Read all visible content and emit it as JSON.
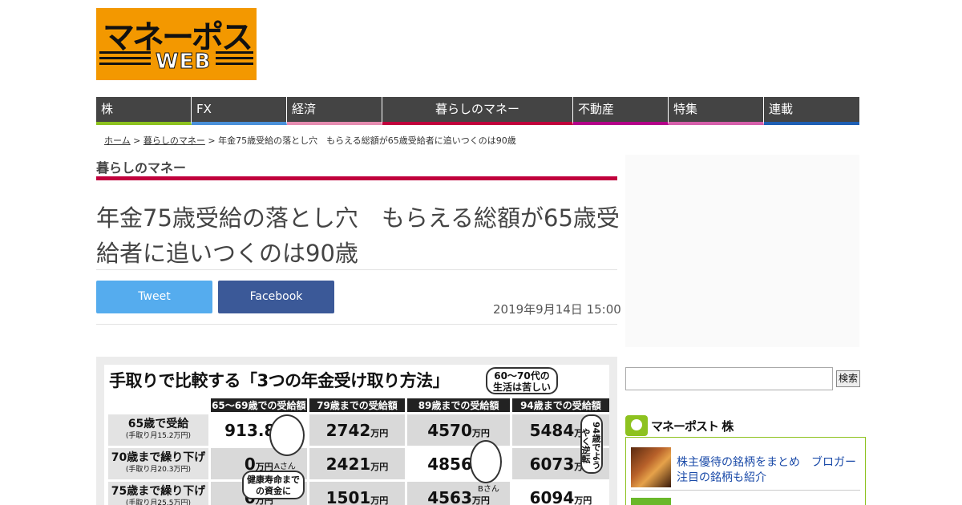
{
  "logo": {
    "main": "マネーポスト",
    "sub": "WEB"
  },
  "nav": [
    {
      "label": "株",
      "color": "#8dc21f"
    },
    {
      "label": "FX",
      "color": "#4a90d9"
    },
    {
      "label": "経済",
      "color": "#e58cb0"
    },
    {
      "label": "暮らしのマネー",
      "color": "#c0003c"
    },
    {
      "label": "不動産",
      "color": "#b40089"
    },
    {
      "label": "特集",
      "color": "#d55faa"
    },
    {
      "label": "連載",
      "color": "#1e5fb4"
    }
  ],
  "breadcrumb": {
    "home": "ホーム",
    "sep1": " > ",
    "category": "暮らしのマネー",
    "sep2": " > ",
    "current": "年金75歳受給の落とし穴　もらえる総額が65歳受給者に追いつくのは90歳"
  },
  "section": {
    "label": "暮らしのマネー",
    "color": "#c0003c"
  },
  "article": {
    "title": "年金75歳受給の落とし穴　もらえる総額が65歳受給者に追いつくのは90歳",
    "date": "2019年9月14日 15:00"
  },
  "share": {
    "tweet": "Tweet",
    "facebook": "Facebook"
  },
  "figure": {
    "title": "手取りで比較する「3つの年金受け取り方法」",
    "bubble_top": "60～70代の\n生活は苦しい",
    "bubble_right": "94歳でようやく逆転",
    "bubble_left": "健康寿命まで\nの資金に",
    "person_a": "Aさん",
    "person_b": "Bさん",
    "columns": [
      "65～69歳での受給額",
      "79歳までの受給額",
      "89歳までの受給額",
      "94歳までの受給額"
    ],
    "rows": [
      {
        "label": "65歳で受給",
        "sub": "(手取り月15.2万円)",
        "values": [
          "913.8",
          "2742",
          "4570",
          "5484"
        ]
      },
      {
        "label": "70歳まで繰り下げ",
        "sub": "(手取り月20.3万円)",
        "values": [
          "0",
          "2421",
          "4856",
          "6073"
        ]
      },
      {
        "label": "75歳まで繰り下げ",
        "sub": "(手取り月25.5万円)",
        "values": [
          "0",
          "1501",
          "4563",
          "6094"
        ]
      }
    ],
    "unit": "万円"
  },
  "sidebar": {
    "search_button": "検索",
    "search_placeholder": "",
    "kabu_logo": "マネーポスト 株",
    "kabu_article": "株主優待の銘柄をまとめ　ブロガー注目の銘柄も紹介"
  }
}
